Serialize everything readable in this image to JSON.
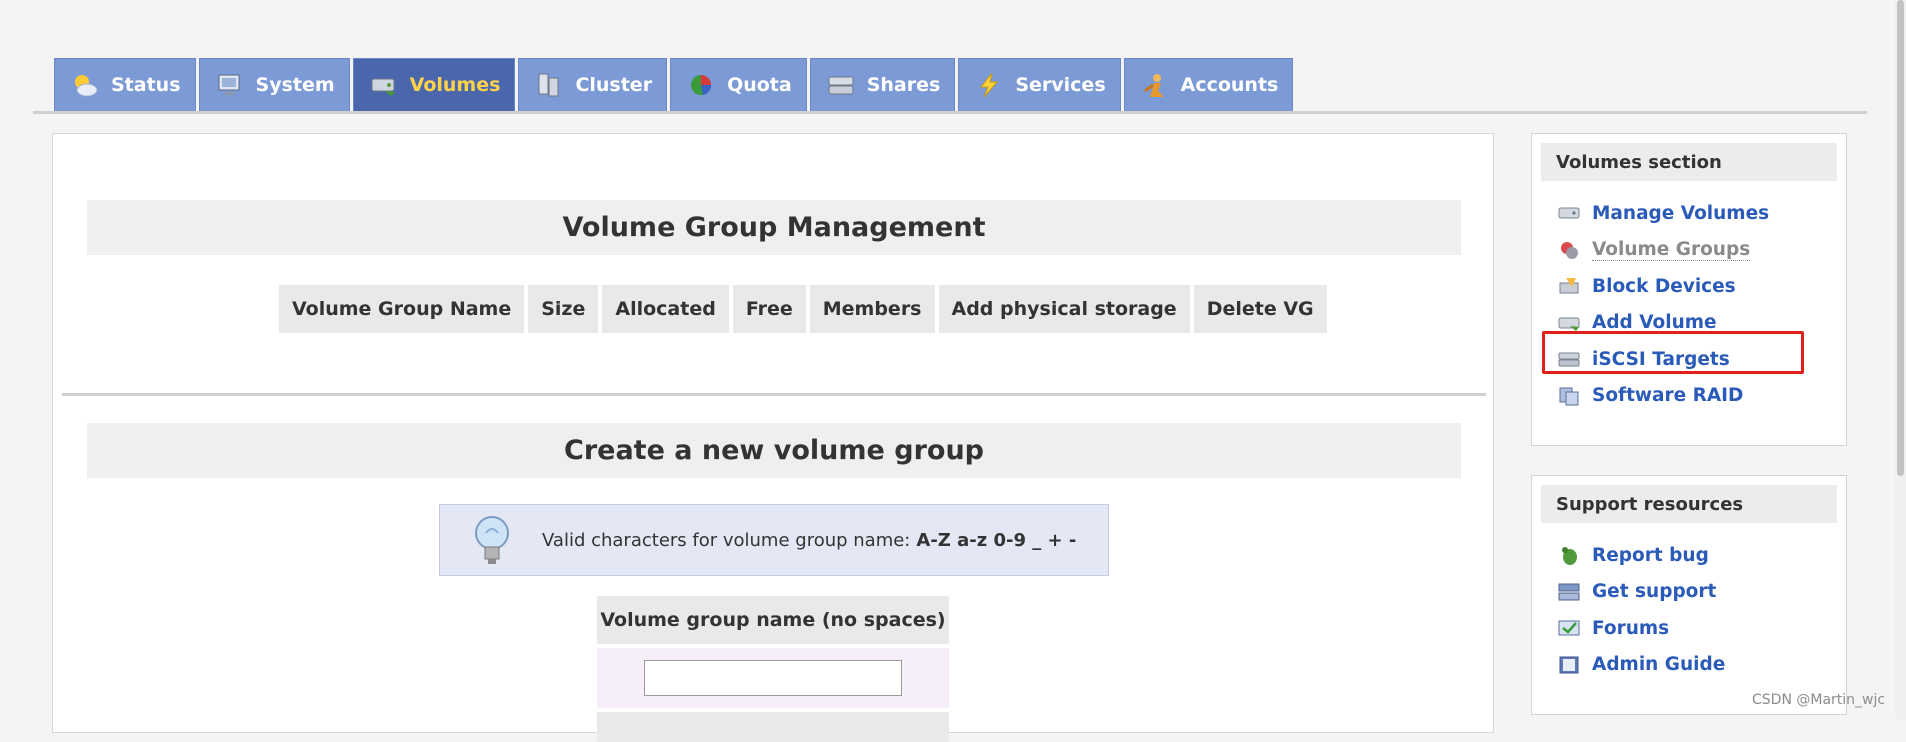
{
  "tabs": [
    {
      "label": "Status",
      "icon": "sun-cloud-icon"
    },
    {
      "label": "System",
      "icon": "monitor-icon"
    },
    {
      "label": "Volumes",
      "icon": "drive-icon",
      "active": true
    },
    {
      "label": "Cluster",
      "icon": "cluster-icon"
    },
    {
      "label": "Quota",
      "icon": "pie-chart-icon"
    },
    {
      "label": "Shares",
      "icon": "shares-icon"
    },
    {
      "label": "Services",
      "icon": "lightning-icon"
    },
    {
      "label": "Accounts",
      "icon": "user-icon"
    }
  ],
  "main": {
    "vg_title": "Volume Group Management",
    "vg_columns": [
      "Volume Group Name",
      "Size",
      "Allocated",
      "Free",
      "Members",
      "Add physical storage",
      "Delete VG"
    ],
    "create_title": "Create a new volume group",
    "hint_text": "Valid characters for volume group name:",
    "hint_chars": "A-Z a-z 0-9 _ + -",
    "form_label": "Volume group name (no spaces)",
    "form_value": ""
  },
  "sidebar": {
    "volumes_section": {
      "title": "Volumes section",
      "items": [
        {
          "label": "Manage Volumes",
          "icon": "drive-icon"
        },
        {
          "label": "Volume Groups",
          "icon": "volume-group-icon",
          "current": true
        },
        {
          "label": "Block Devices",
          "icon": "block-device-icon"
        },
        {
          "label": "Add Volume",
          "icon": "add-volume-icon"
        },
        {
          "label": "iSCSI Targets",
          "icon": "iscsi-icon"
        },
        {
          "label": "Software RAID",
          "icon": "raid-icon"
        }
      ]
    },
    "support_section": {
      "title": "Support resources",
      "items": [
        {
          "label": "Report bug",
          "icon": "bug-icon"
        },
        {
          "label": "Get support",
          "icon": "support-icon"
        },
        {
          "label": "Forums",
          "icon": "forums-icon"
        },
        {
          "label": "Admin Guide",
          "icon": "guide-icon"
        }
      ]
    }
  },
  "watermark": "CSDN @Martin_wjc",
  "colors": {
    "tab_bg": "#7c9ad6",
    "tab_active_bg": "#4a67ad",
    "tab_active_text": "#ffd24a",
    "link": "#2b5bb8",
    "highlight": "#e0201b"
  }
}
